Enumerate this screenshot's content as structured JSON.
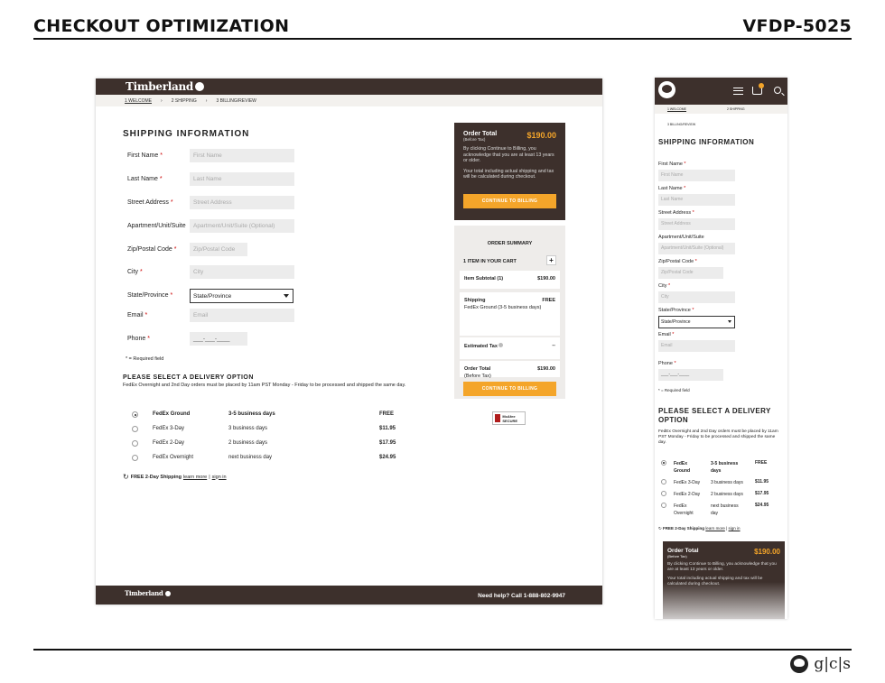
{
  "header": {
    "title": "CHECKOUT OPTIMIZATION",
    "code": "VFDP-5025",
    "gcs": "g|c|s"
  },
  "desktop": {
    "brand": "Timberland",
    "steps": [
      "1  WELCOME",
      "2  SHIPPING",
      "3  BILLING/REVIEW"
    ],
    "section_title": "SHIPPING INFORMATION",
    "fields": [
      {
        "label": "First Name",
        "required": "*",
        "placeholder": "First Name"
      },
      {
        "label": "Last Name",
        "required": "*",
        "placeholder": "Last Name"
      },
      {
        "label": "Street Address",
        "required": "*",
        "placeholder": "Street Address"
      },
      {
        "label": "Apartment/Unit/Suite",
        "required": "",
        "placeholder": "Apartment/Unit/Suite (Optional)"
      },
      {
        "label": "Zip/Postal Code",
        "required": "*",
        "placeholder": "Zip/Postal Code"
      },
      {
        "label": "City",
        "required": "*",
        "placeholder": "City"
      },
      {
        "label": "State/Province",
        "required": "*",
        "placeholder": "State/Province"
      },
      {
        "label": "Email",
        "required": "*",
        "placeholder": "Email"
      },
      {
        "label": "Phone",
        "required": "*",
        "placeholder": "___-___-____"
      }
    ],
    "required_note": "* = Required field",
    "delivery_title": "PLEASE SELECT A DELIVERY OPTION",
    "delivery_text": "FedEx Overnight and 2nd Day orders must be placed by 11am PST Monday - Friday to be processed and shipped the same day.",
    "options": [
      {
        "name": "FedEx Ground",
        "time": "3-5 business days",
        "price": "FREE"
      },
      {
        "name": "FedEx 3-Day",
        "time": "3 business days",
        "price": "$11.95"
      },
      {
        "name": "FedEx 2-Day",
        "time": "2 business days",
        "price": "$17.95"
      },
      {
        "name": "FedEx Overnight",
        "time": "next business day",
        "price": "$24.95"
      }
    ],
    "free_shipping": "FREE 2-Day Shipping",
    "learn_more": "learn more",
    "sep": "|",
    "sign_in": "sign in",
    "order_total_label": "Order Total",
    "order_total": "$190.00",
    "before_tax": "(Before Tax)",
    "ack": "By clicking Continue to Billing, you acknowledge that you are at least 13 years or older.",
    "total_note": "Your total including actual shipping and tax will be calculated during checkout.",
    "continue": "CONTINUE TO BILLING",
    "summary_title": "ORDER SUMMARY",
    "cart": "1 ITEM IN YOUR CART",
    "plus": "+",
    "subtotal_label": "Item Subtotal (1)",
    "subtotal": "$190.00",
    "shipping_label": "Shipping",
    "shipping": "FREE",
    "shipping_method": "FedEx Ground (3-5 business days)",
    "tax_label": "Estimated Tax",
    "tax": "--",
    "total_label": "Order Total",
    "total": "$190.00",
    "total_sub": "(Before Tax)",
    "secure": "McAfee SECURE",
    "help": "Need help? Call 1-888-802-9947"
  },
  "mobile": {
    "steps": [
      "1  WELCOME",
      "2  SHIPPING",
      "3  BILLING/REVIEW"
    ],
    "section_title": "SHIPPING INFORMATION",
    "fields": [
      {
        "label": "First Name",
        "required": "*",
        "placeholder": "First Name"
      },
      {
        "label": "Last Name",
        "required": "*",
        "placeholder": "Last Name"
      },
      {
        "label": "Street Address",
        "required": "*",
        "placeholder": "Street Address"
      },
      {
        "label": "Apartment/Unit/Suite",
        "required": "",
        "placeholder": "Apartment/Unit/Suite (Optional)"
      },
      {
        "label": "Zip/Postal Code",
        "required": "*",
        "placeholder": "Zip/Postal Code"
      },
      {
        "label": "City",
        "required": "*",
        "placeholder": "City"
      },
      {
        "label": "State/Province",
        "required": "*",
        "placeholder": "State/Province"
      },
      {
        "label": "Email",
        "required": "*",
        "placeholder": "Email"
      },
      {
        "label": "Phone",
        "required": "*",
        "placeholder": "___-___-____"
      }
    ],
    "required_note": "* = Required field",
    "delivery_title": "PLEASE SELECT A DELIVERY OPTION",
    "delivery_text": "FedEx Overnight and 2nd Day orders must be placed by 11am PST Monday - Friday to be processed and shipped the same day.",
    "order_total_label": "Order Total",
    "order_total": "$190.00",
    "before_tax": "(Before Tax)",
    "ack": "By clicking Continue to Billing, you acknowledge that you are at least 13 years or older.",
    "total_note": "Your total including actual shipping and tax will be calculated during checkout."
  }
}
